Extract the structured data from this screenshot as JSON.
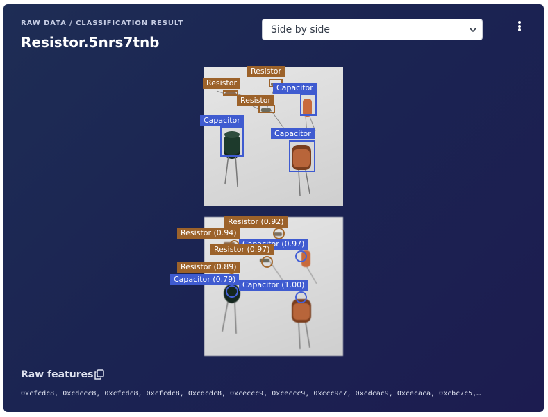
{
  "header": {
    "subtitle": "RAW DATA / CLASSIFICATION RESULT",
    "title": "Resistor.5nrs7tnb"
  },
  "view_select": {
    "value": "Side by side"
  },
  "menu": {
    "icon": "kebab-menu-icon"
  },
  "top_labels": [
    "Resistor",
    "Resistor",
    "Capacitor",
    "Resistor",
    "Capacitor",
    "Capacitor"
  ],
  "bottom_labels": [
    "Resistor (0.92)",
    "Resistor (0.94)",
    "Capacitor (0.97)",
    "Resistor (0.97)",
    "Resistor (0.89)",
    "Capacitor (0.79)",
    "Capacitor (1.00)"
  ],
  "raw_features": {
    "title": "Raw features",
    "copy_icon": "copy-icon",
    "values": "0xcfcdc8, 0xcdccc8, 0xcfcdc8, 0xcfcdc8, 0xcdcdc8, 0xceccc9, 0xceccc9, 0xccc9c7, 0xcdcac9, 0xcecaca, 0xcbc7c5,…"
  },
  "colors": {
    "resistor": "#9c622a",
    "capacitor": "#3f5bd0",
    "background": "#1b2452"
  }
}
